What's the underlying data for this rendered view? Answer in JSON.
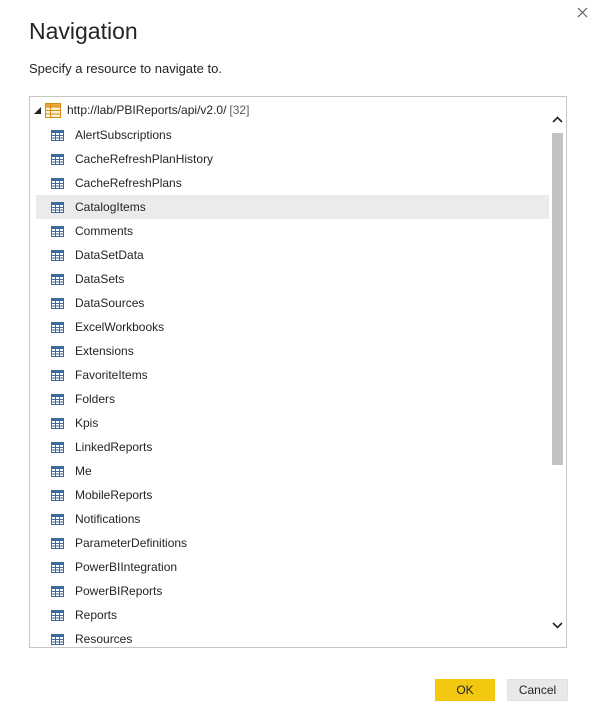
{
  "dialog": {
    "title": "Navigation",
    "subtitle": "Specify a resource to navigate to."
  },
  "tree": {
    "root": {
      "label": "http://lab/PBIReports/api/v2.0/",
      "count": "[32]"
    },
    "items": [
      {
        "label": "AlertSubscriptions"
      },
      {
        "label": "CacheRefreshPlanHistory"
      },
      {
        "label": "CacheRefreshPlans"
      },
      {
        "label": "CatalogItems",
        "selected": true
      },
      {
        "label": "Comments"
      },
      {
        "label": "DataSetData"
      },
      {
        "label": "DataSets"
      },
      {
        "label": "DataSources"
      },
      {
        "label": "ExcelWorkbooks"
      },
      {
        "label": "Extensions"
      },
      {
        "label": "FavoriteItems"
      },
      {
        "label": "Folders"
      },
      {
        "label": "Kpis"
      },
      {
        "label": "LinkedReports"
      },
      {
        "label": "Me"
      },
      {
        "label": "MobileReports"
      },
      {
        "label": "Notifications"
      },
      {
        "label": "ParameterDefinitions"
      },
      {
        "label": "PowerBIIntegration"
      },
      {
        "label": "PowerBIReports"
      },
      {
        "label": "Reports"
      },
      {
        "label": "Resources"
      }
    ]
  },
  "buttons": {
    "ok": "OK",
    "cancel": "Cancel"
  },
  "colors": {
    "accent": "#f2c811",
    "selection": "#ebebeb",
    "icon_blue": "#3e6b9e"
  },
  "icons": {
    "close": "close-icon",
    "expander": "triangle-expanded-icon",
    "root": "table-group-icon",
    "item": "table-icon",
    "scroll_up": "chevron-up-icon",
    "scroll_down": "chevron-down-icon"
  }
}
